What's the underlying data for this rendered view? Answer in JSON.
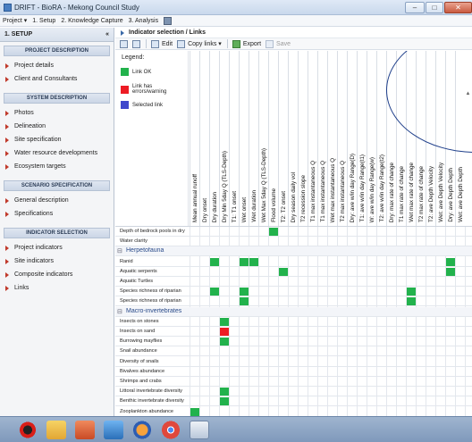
{
  "window": {
    "title": "DRIFT - BioRA - Mekong Council Study"
  },
  "menubar": {
    "items": [
      "Project ▾",
      "1. Setup",
      "2. Knowledge Capture",
      "3. Analysis"
    ]
  },
  "sidebar": {
    "header": "1. SETUP",
    "collapse_glyph": "«",
    "sections": [
      {
        "title": "PROJECT DESCRIPTION",
        "items": [
          "Project details",
          "Client and Consultants"
        ]
      },
      {
        "title": "SYSTEM DESCRIPTION",
        "items": [
          "Photos",
          "Delineation",
          "Site specification",
          "Water resource developments",
          "Ecosystem targets"
        ]
      },
      {
        "title": "SCENARIO SPECIFICATION",
        "items": [
          "General description",
          "Specifications"
        ]
      },
      {
        "title": "INDICATOR SELECTION",
        "items": [
          "Project indicators",
          "Site indicators",
          "Composite indicators",
          "Links"
        ]
      }
    ]
  },
  "breadcrumb": "Indicator selection / Links",
  "toolbar": {
    "edit": "Edit",
    "copy_links": "Copy links ▾",
    "export": "Export",
    "save": "Save"
  },
  "legend": {
    "title": "Legend:",
    "items": [
      {
        "label": "Link OK",
        "color": "#22b24c"
      },
      {
        "label": "Link has errors/warning",
        "color": "#ed1c24"
      },
      {
        "label": "Selected link",
        "color": "#3f48cc"
      }
    ]
  },
  "columns": [
    "Mean annual runoff",
    "Dry onset",
    "Dry duration",
    "Dry Min 5day Q (TLS-Depth)",
    "T1: T1 onset",
    "Wet onset",
    "Wet duration",
    "Wet Max 5day Q (TLS-Depth)",
    "Flood volume",
    "T2: T2 onset",
    "Dry season daily vol",
    "T2 recession slope",
    "T1 max instantaneous Q",
    "T1 max instantaneous Q",
    "Wet max instantaneous Q",
    "T2 max instantaneous Q",
    "Dry: ave w/in day Range(D)",
    "T1: ave w/in day Range(t1)",
    "W: ave w/in day Range(w)",
    "T2: ave w/in day Range(t2)",
    "Dry: max rate of change",
    "T1 max rate of change",
    "Wet max rate of change",
    "T2 max rate of change",
    "T2: ave Depth Velocity",
    "Wet: ave Depth Velocity",
    "Dry: ave Depth Depth",
    "Wet: ave Depth Depth"
  ],
  "rows": [
    {
      "label": "Depth of bedrock pools in dry",
      "cells": [
        {
          "col": 8,
          "status": "ok"
        }
      ]
    },
    {
      "label": "Water clarity",
      "cells": []
    },
    {
      "label": "Herpetofauna",
      "group": true,
      "cells": []
    },
    {
      "label": "Ranid",
      "cells": [
        {
          "col": 2,
          "status": "ok"
        },
        {
          "col": 5,
          "status": "ok"
        },
        {
          "col": 6,
          "status": "ok"
        },
        {
          "col": 26,
          "status": "ok"
        }
      ]
    },
    {
      "label": "Aquatic serpents",
      "cells": [
        {
          "col": 9,
          "status": "ok"
        },
        {
          "col": 26,
          "status": "ok"
        }
      ]
    },
    {
      "label": "Aquatic Turtles",
      "cells": []
    },
    {
      "label": "Species richness of riparian",
      "cells": [
        {
          "col": 2,
          "status": "ok"
        },
        {
          "col": 5,
          "status": "ok"
        },
        {
          "col": 22,
          "status": "ok"
        }
      ]
    },
    {
      "label": "Species richness of riparian",
      "cells": [
        {
          "col": 5,
          "status": "ok"
        },
        {
          "col": 22,
          "status": "ok"
        }
      ]
    },
    {
      "label": "Macro-invertebrates",
      "group": true,
      "cells": []
    },
    {
      "label": "Insects on stones",
      "cells": [
        {
          "col": 3,
          "status": "ok"
        }
      ]
    },
    {
      "label": "Insects on sand",
      "cells": [
        {
          "col": 3,
          "status": "error"
        }
      ]
    },
    {
      "label": "Burrowing mayflies",
      "cells": [
        {
          "col": 3,
          "status": "ok"
        }
      ]
    },
    {
      "label": "Snail abundance",
      "cells": []
    },
    {
      "label": "Diversity of snails",
      "cells": []
    },
    {
      "label": "Bivalves abundance",
      "cells": []
    },
    {
      "label": "Shrimps and crabs",
      "cells": []
    },
    {
      "label": "Littoral invertebrate diversity",
      "cells": [
        {
          "col": 3,
          "status": "ok"
        }
      ]
    },
    {
      "label": "Benthic invertebrate diversity",
      "cells": [
        {
          "col": 3,
          "status": "ok"
        }
      ]
    },
    {
      "label": "Zooplankton abundance",
      "cells": [
        {
          "col": 0,
          "status": "ok"
        }
      ]
    }
  ],
  "taskbar": {
    "items": [
      "start-orb",
      "file-explorer",
      "powerpoint",
      "charts-app",
      "firefox",
      "chrome",
      "drift-app"
    ]
  }
}
